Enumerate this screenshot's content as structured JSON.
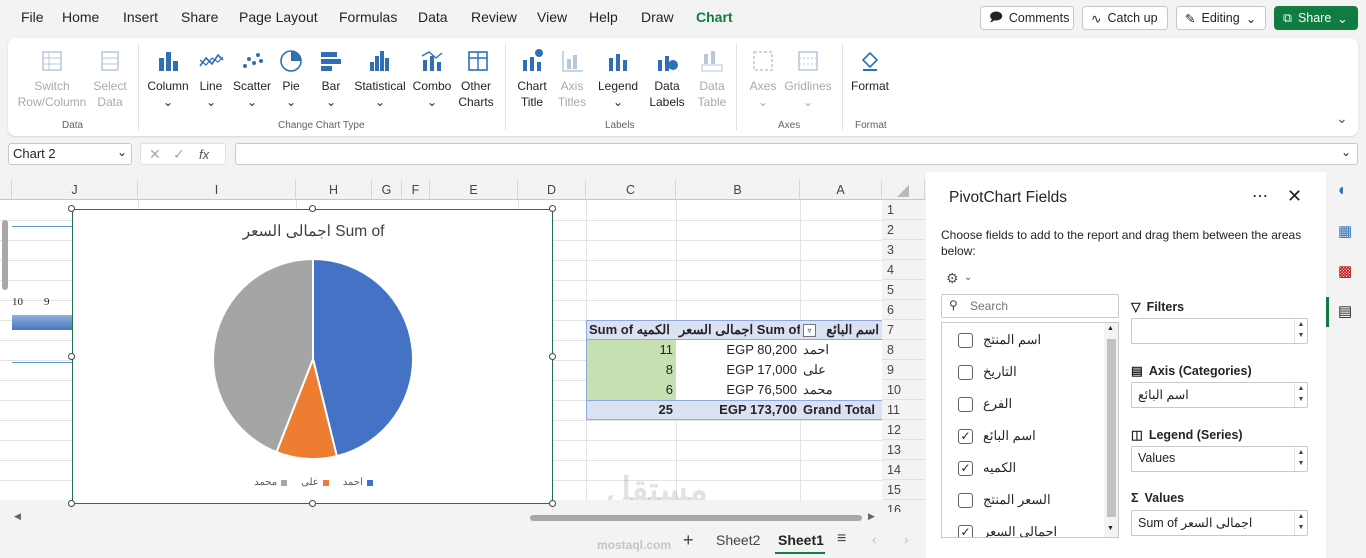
{
  "menu": [
    "File",
    "Home",
    "Insert",
    "Share",
    "Page Layout",
    "Formulas",
    "Data",
    "Review",
    "View",
    "Help",
    "Draw",
    "Chart"
  ],
  "topbar": {
    "comments": "Comments",
    "catchup": "Catch up",
    "editing": "Editing",
    "share": "Share"
  },
  "ribbon": {
    "switch": "Switch Row/Column",
    "select": "Select Data",
    "data_group": "Data",
    "column": "Column",
    "line": "Line",
    "scatter": "Scatter",
    "pie": "Pie",
    "bar": "Bar",
    "statistical": "Statistical",
    "combo": "Combo",
    "other": "Other Charts",
    "type_group": "Change Chart Type",
    "charttitle": "Chart Title",
    "axistitles": "Axis Titles",
    "legend": "Legend",
    "datalabels": "Data Labels",
    "datatable": "Data Table",
    "labels_group": "Labels",
    "axes": "Axes",
    "gridlines": "Gridlines",
    "axes_group": "Axes",
    "format": "Format",
    "format_group": "Format"
  },
  "namebox": "Chart 2",
  "fx": "fx",
  "columns": [
    "J",
    "I",
    "H",
    "G",
    "F",
    "E",
    "D",
    "C",
    "B",
    "A"
  ],
  "rows": [
    "1",
    "2",
    "3",
    "4",
    "5",
    "6",
    "7",
    "8",
    "9",
    "10",
    "11",
    "12",
    "13",
    "14",
    "15",
    "16"
  ],
  "pivot": {
    "headers": {
      "name": "اسم البائع",
      "total": "اجمالى السعر Sum of",
      "qty": "Sum of الكميه"
    },
    "rows": [
      {
        "name": "احمد",
        "total": "EGP 80,200",
        "qty": "11"
      },
      {
        "name": "على",
        "total": "EGP 17,000",
        "qty": "8"
      },
      {
        "name": "محمد",
        "total": "EGP 76,500",
        "qty": "6"
      }
    ],
    "grand": {
      "label": "Grand Total",
      "total": "EGP 173,700",
      "qty": "25"
    }
  },
  "left_strip": {
    "n1": "10",
    "n2": "9"
  },
  "chart_data": {
    "type": "pie",
    "title": "اجمالى السعر Sum of",
    "categories": [
      "احمد",
      "على",
      "محمد"
    ],
    "values": [
      80200,
      17000,
      76500
    ],
    "colors": [
      "#4472c4",
      "#ed7d31",
      "#a5a5a5"
    ],
    "legend": "bottom"
  },
  "tabs": {
    "add": "+",
    "sheet2": "Sheet2",
    "sheet1": "Sheet1"
  },
  "pane": {
    "title": "PivotChart Fields",
    "desc": "Choose fields to add to the report and drag them between the areas below:",
    "search_placeholder": "Search",
    "fields": [
      {
        "label": "اسم المنتج",
        "checked": false
      },
      {
        "label": "التاريخ",
        "checked": false
      },
      {
        "label": "الفرع",
        "checked": false
      },
      {
        "label": "اسم البائع",
        "checked": true
      },
      {
        "label": "الكميه",
        "checked": true
      },
      {
        "label": "السعر المنتج",
        "checked": false
      },
      {
        "label": "اجمالى السعر",
        "checked": true
      }
    ],
    "filters": "Filters",
    "axis": "Axis (Categories)",
    "axis_value": "اسم البائع",
    "legend": "Legend (Series)",
    "legend_value": "Values",
    "values": "Values",
    "values_value": "Sum of اجمالى السعر"
  },
  "watermark": {
    "text": "مستقل",
    "sub": "mostaql.com"
  },
  "colors": {
    "accent": "#107c41",
    "selection": "#c6e0b4",
    "pivot_header": "#d9e1f2"
  }
}
